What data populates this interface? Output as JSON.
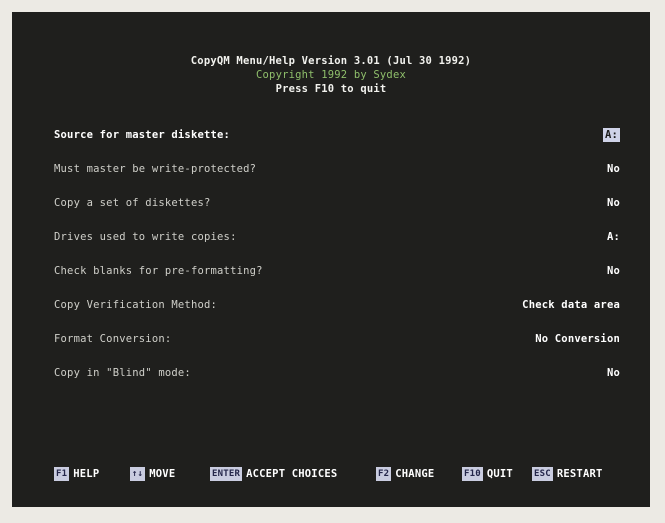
{
  "header": {
    "title": "CopyQM Menu/Help Version 3.01 (Jul 30 1992)",
    "copyright": "Copyright 1992 by Sydex",
    "quit_hint": "Press F10 to quit"
  },
  "settings": [
    {
      "label": "Source for master diskette:",
      "value": "A:"
    },
    {
      "label": "Must master be write-protected?",
      "value": "No"
    },
    {
      "label": "Copy a set of diskettes?",
      "value": "No"
    },
    {
      "label": "Drives used to write copies:",
      "value": "A:"
    },
    {
      "label": "Check blanks for pre-formatting?",
      "value": "No"
    },
    {
      "label": "Copy Verification Method:",
      "value": "Check data area"
    },
    {
      "label": "Format Conversion:",
      "value": "No Conversion"
    },
    {
      "label": "Copy in \"Blind\" mode:",
      "value": "No"
    }
  ],
  "footer": {
    "keys": [
      {
        "key": "F1",
        "action": "HELP"
      },
      {
        "key": "↑↓",
        "action": "MOVE"
      },
      {
        "key": "ENTER",
        "action": "ACCEPT CHOICES"
      },
      {
        "key": "F2",
        "action": "CHANGE"
      },
      {
        "key": "F10",
        "action": "QUIT"
      },
      {
        "key": "ESC",
        "action": "RESTART"
      }
    ]
  },
  "colors": {
    "screen_background": "#1f1f1d",
    "copyright_text": "#8fbf6b",
    "keycap": "#c9cce0",
    "highlight": "#cfd3e8"
  }
}
